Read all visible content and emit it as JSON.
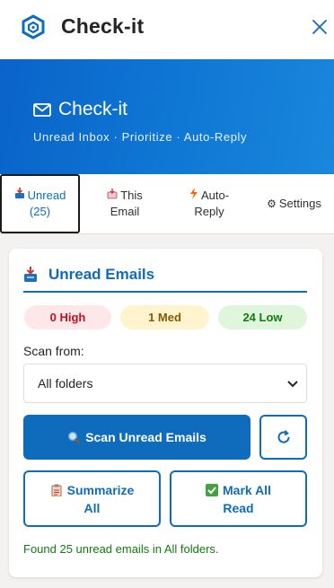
{
  "app": {
    "title": "Check-it",
    "close_icon": "close-icon",
    "logo_icon": "hexagon-logo-icon"
  },
  "hero": {
    "title": "Check-it",
    "subtitle": "Unread Inbox · Prioritize · Auto-Reply",
    "icon": "mail-icon"
  },
  "tabs": [
    {
      "line1": "Unread",
      "line2": "(25)",
      "icon": "inbox-tray-icon"
    },
    {
      "line1": "This",
      "line2": "Email",
      "icon": "envelope-arrow-icon"
    },
    {
      "line1": "Auto-",
      "line2": "Reply",
      "icon": "lightning-icon"
    },
    {
      "line1": "Settings",
      "line2": "",
      "icon": "gear-icon"
    }
  ],
  "card": {
    "title": "Unread Emails",
    "icon": "inbox-tray-icon",
    "counts": {
      "high": "0 High",
      "med": "1 Med",
      "low": "24 Low"
    },
    "scan_label": "Scan from:",
    "scan_value": "All folders",
    "scan_button": "Scan Unread Emails",
    "summarize_line1": "Summarize",
    "summarize_line2": "All",
    "markread_line1": "Mark All",
    "markread_line2": "Read",
    "status": "Found 25 unread emails in All folders."
  },
  "colors": {
    "accent": "#0f6cbd",
    "high": "#c50f1f",
    "med": "#835b00",
    "low": "#107c10"
  }
}
